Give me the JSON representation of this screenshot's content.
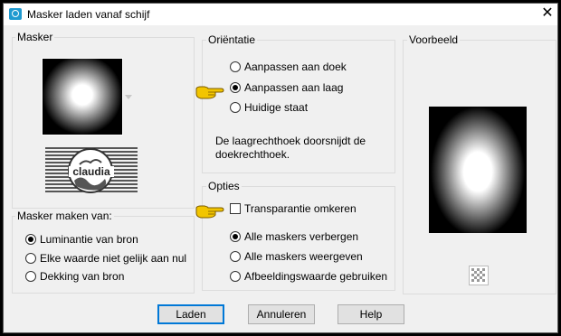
{
  "window": {
    "title": "Masker laden vanaf schijf"
  },
  "masker_group": {
    "label": "Masker",
    "logo_text": "claudia"
  },
  "source_group": {
    "label": "Masker maken van:",
    "options": [
      {
        "label": "Luminantie van bron",
        "selected": true
      },
      {
        "label": "Elke waarde niet gelijk aan nul",
        "selected": false
      },
      {
        "label": "Dekking van bron",
        "selected": false
      }
    ]
  },
  "orientation_group": {
    "label": "Oriëntatie",
    "options": [
      {
        "label": "Aanpassen aan doek",
        "selected": false
      },
      {
        "label": "Aanpassen aan laag",
        "selected": true
      },
      {
        "label": "Huidige staat",
        "selected": false
      }
    ],
    "description": "De laagrechthoek doorsnijdt de doekrechthoek."
  },
  "options_group": {
    "label": "Opties",
    "invert": {
      "label": "Transparantie omkeren",
      "checked": false
    },
    "mask_options": [
      {
        "label": "Alle maskers verbergen",
        "selected": true
      },
      {
        "label": "Alle maskers weergeven",
        "selected": false
      },
      {
        "label": "Afbeeldingswaarde gebruiken",
        "selected": false
      }
    ]
  },
  "preview_group": {
    "label": "Voorbeeld"
  },
  "buttons": {
    "load": "Laden",
    "cancel": "Annuleren",
    "help": "Help"
  },
  "icons": {
    "app": "paintshop-icon",
    "close": "close-icon",
    "dropdown": "chevron-down-icon",
    "pointer": "pointing-hand-icon",
    "transparency": "checkerboard-icon"
  },
  "colors": {
    "accent": "#0078d7",
    "pointer_hand": "#f2c500"
  }
}
